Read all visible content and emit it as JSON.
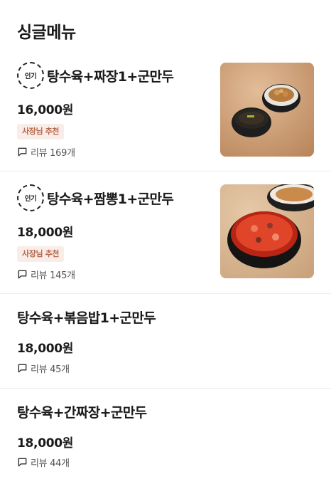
{
  "section": {
    "title": "싱글메뉴"
  },
  "items": [
    {
      "popular": true,
      "badge_label": "인기",
      "name": "탕수육+짜장1+군만두",
      "price": "16,000원",
      "tag": "사장님 추천",
      "review": "리뷰 169개",
      "has_image": true
    },
    {
      "popular": true,
      "badge_label": "인기",
      "name": "탕수육+짬뽕1+군만두",
      "price": "18,000원",
      "tag": "사장님 추천",
      "review": "리뷰 145개",
      "has_image": true
    },
    {
      "popular": false,
      "name": "탕수육+볶음밥1+군만두",
      "price": "18,000원",
      "review": "리뷰 45개",
      "has_image": false
    },
    {
      "popular": false,
      "name": "탕수육+간짜장+군만두",
      "price": "18,000원",
      "review": "리뷰 44개",
      "has_image": false
    }
  ],
  "icons": {
    "badge": "popular-badge-icon",
    "review": "speech-bubble-icon"
  }
}
